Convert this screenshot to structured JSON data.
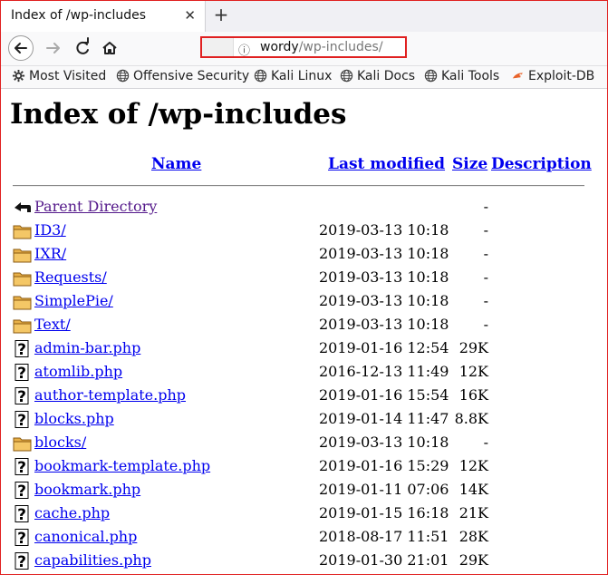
{
  "tab": {
    "title": "Index of /wp-includes",
    "close_glyph": "✕",
    "new_tab_glyph": "+"
  },
  "url": {
    "host": "wordy",
    "path": "/wp-includes/"
  },
  "bookmarks": [
    {
      "label": "Most Visited",
      "icon": "gear-icon"
    },
    {
      "label": "Offensive Security",
      "icon": "globe-icon"
    },
    {
      "label": "Kali Linux",
      "icon": "globe-icon"
    },
    {
      "label": "Kali Docs",
      "icon": "globe-icon"
    },
    {
      "label": "Kali Tools",
      "icon": "globe-icon"
    },
    {
      "label": "Exploit-DB",
      "icon": "exploit-db-icon"
    }
  ],
  "page": {
    "heading": "Index of /wp-includes",
    "columns": {
      "name": "Name",
      "modified": "Last modified",
      "size": "Size",
      "description": "Description"
    },
    "rows": [
      {
        "icon": "back-arrow-icon",
        "name": "Parent Directory",
        "date": "",
        "size": "-",
        "visited": true
      },
      {
        "icon": "folder-icon",
        "name": "ID3/",
        "date": "2019-03-13 10:18",
        "size": "-"
      },
      {
        "icon": "folder-icon",
        "name": "IXR/",
        "date": "2019-03-13 10:18",
        "size": "-"
      },
      {
        "icon": "folder-icon",
        "name": "Requests/",
        "date": "2019-03-13 10:18",
        "size": "-"
      },
      {
        "icon": "folder-icon",
        "name": "SimplePie/",
        "date": "2019-03-13 10:18",
        "size": "-"
      },
      {
        "icon": "folder-icon",
        "name": "Text/",
        "date": "2019-03-13 10:18",
        "size": "-"
      },
      {
        "icon": "unknown-file-icon",
        "name": "admin-bar.php",
        "date": "2019-01-16 12:54",
        "size": "29K"
      },
      {
        "icon": "unknown-file-icon",
        "name": "atomlib.php",
        "date": "2016-12-13 11:49",
        "size": "12K"
      },
      {
        "icon": "unknown-file-icon",
        "name": "author-template.php",
        "date": "2019-01-16 15:54",
        "size": "16K"
      },
      {
        "icon": "unknown-file-icon",
        "name": "blocks.php",
        "date": "2019-01-14 11:47",
        "size": "8.8K"
      },
      {
        "icon": "folder-icon",
        "name": "blocks/",
        "date": "2019-03-13 10:18",
        "size": "-"
      },
      {
        "icon": "unknown-file-icon",
        "name": "bookmark-template.php",
        "date": "2019-01-16 15:29",
        "size": "12K"
      },
      {
        "icon": "unknown-file-icon",
        "name": "bookmark.php",
        "date": "2019-01-11 07:06",
        "size": "14K"
      },
      {
        "icon": "unknown-file-icon",
        "name": "cache.php",
        "date": "2019-01-15 16:18",
        "size": "21K"
      },
      {
        "icon": "unknown-file-icon",
        "name": "canonical.php",
        "date": "2018-08-17 11:51",
        "size": "28K"
      },
      {
        "icon": "unknown-file-icon",
        "name": "capabilities.php",
        "date": "2019-01-30 21:01",
        "size": "29K"
      }
    ]
  }
}
